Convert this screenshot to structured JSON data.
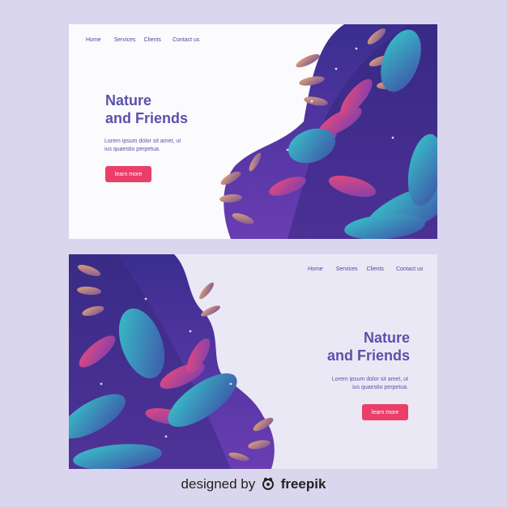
{
  "banners": {
    "top": {
      "nav": [
        "Home",
        "Services",
        "Clients",
        "Contact us"
      ],
      "title_line1": "Nature",
      "title_line2": "and Friends",
      "desc_line1": "Lorem ipsum dolor sit amet, ut",
      "desc_line2": "ius quaestio perpetua.",
      "button": "learn more"
    },
    "bottom": {
      "nav": [
        "Home",
        "Services",
        "Clients",
        "Contact us"
      ],
      "title_line1": "Nature",
      "title_line2": "and Friends",
      "desc_line1": "Lorem ipsum dolor sit amet, ut",
      "desc_line2": "ius quaestio perpetua.",
      "button": "learn more"
    }
  },
  "credit": {
    "prefix": "designed by",
    "brand": "freepik"
  },
  "colors": {
    "background": "#d9d6ee",
    "accent": "#ea3f69",
    "heading": "#5a52a8",
    "leaf_teal": "#2fb8c4",
    "leaf_purple": "#6f3fb8",
    "leaf_tan": "#c9936a"
  }
}
